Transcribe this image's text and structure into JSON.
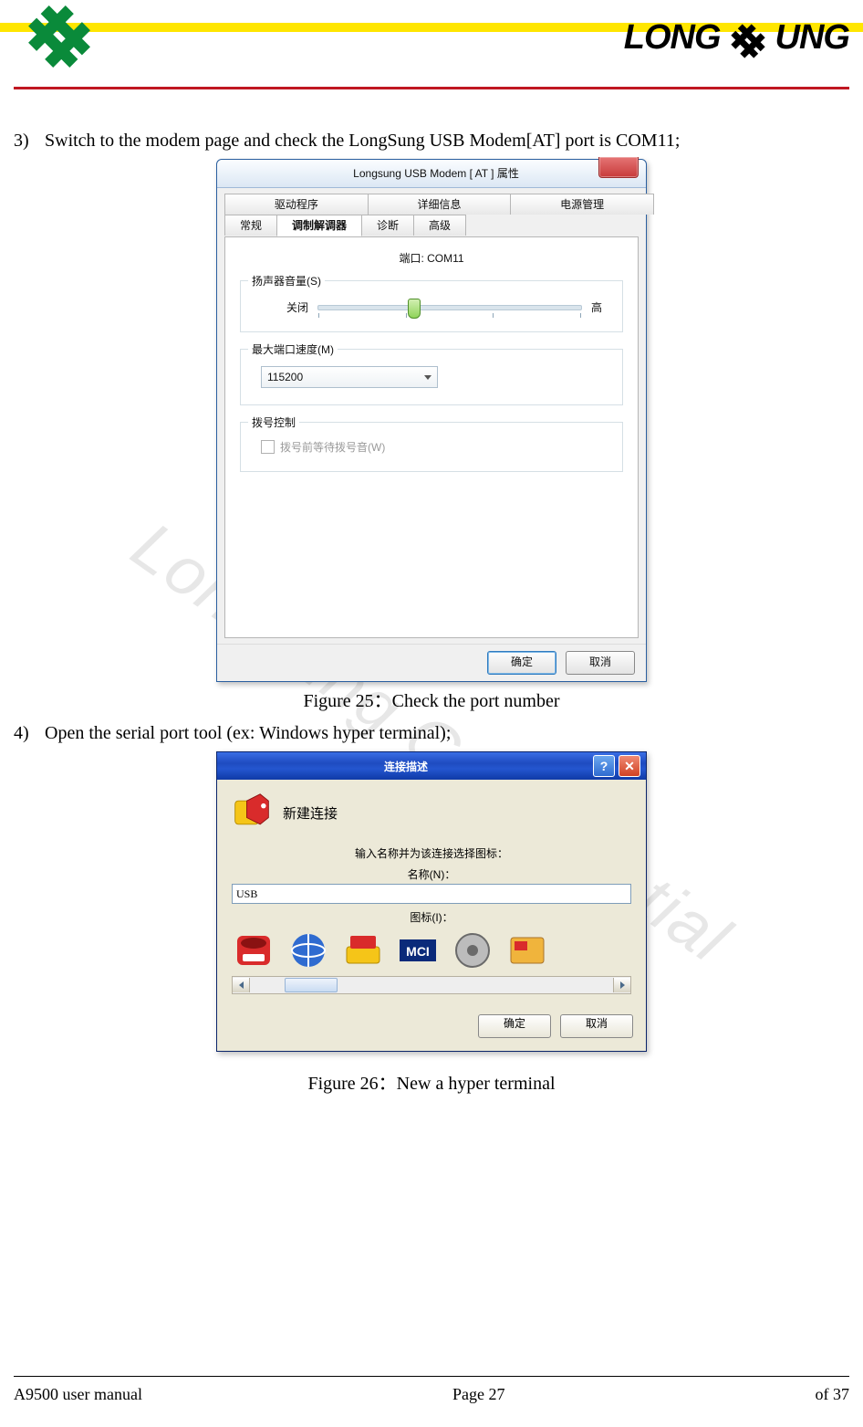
{
  "watermark": "Longsung Confidential",
  "brand": {
    "left": "LONG",
    "right": "UNG"
  },
  "step3": {
    "num": "3)",
    "text": "Switch to the modem page and check the LongSung USB Modem[AT] port is COM11;"
  },
  "step4": {
    "num": "4)",
    "text": "Open the serial port tool (ex: Windows hyper terminal);"
  },
  "fig25": "Figure 25：Check the port number",
  "fig26": "Figure 26：New a hyper terminal",
  "dlg1": {
    "title": "Longsung USB Modem [ AT ] 属性",
    "tabs_top": [
      "驱动程序",
      "详细信息",
      "电源管理"
    ],
    "tabs_bot": [
      "常规",
      "调制解调器",
      "诊断",
      "高级"
    ],
    "port_line": "端口: COM11",
    "g1": {
      "title": "扬声器音量(S)",
      "off": "关闭",
      "high": "高"
    },
    "g2": {
      "title": "最大端口速度(M)",
      "value": "115200"
    },
    "g3": {
      "title": "拨号控制",
      "chk": "拨号前等待拨号音(W)"
    },
    "ok": "确定",
    "cancel": "取消"
  },
  "dlg2": {
    "title": "连接描述",
    "heading": "新建连接",
    "prompt": "输入名称并为该连接选择图标：",
    "name_lbl": "名称(N)：",
    "name_val": "USB",
    "icon_lbl": "图标(I)：",
    "ok": "确定",
    "cancel": "取消"
  },
  "footer": {
    "left": "A9500 user manual",
    "center": "Page 27",
    "right": "of 37"
  }
}
